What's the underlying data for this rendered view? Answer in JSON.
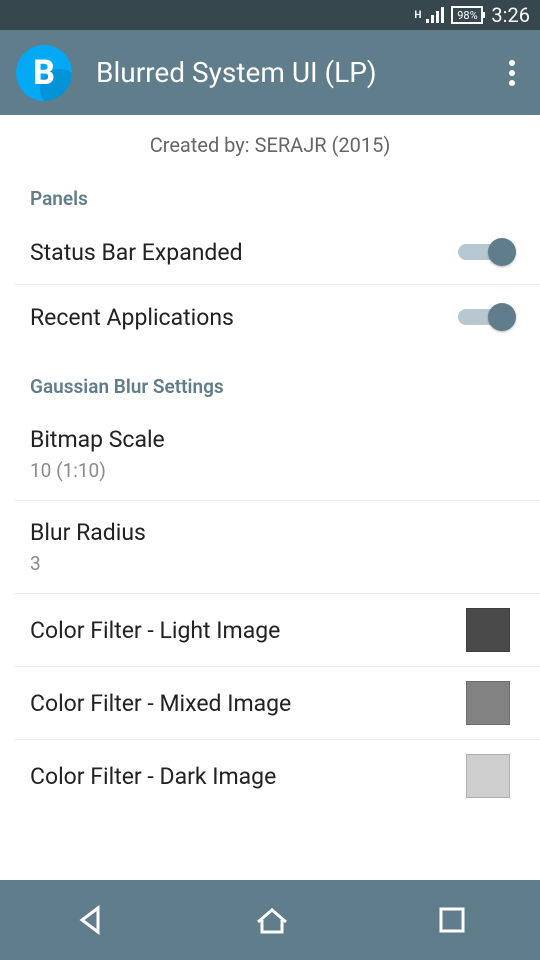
{
  "status": {
    "indicator": "H",
    "battery": "98%",
    "time": "3:26"
  },
  "appbar": {
    "icon_letter": "B",
    "title": "Blurred System UI (LP)"
  },
  "created_by": "Created by: SERAJR (2015)",
  "sections": {
    "panels": {
      "header": "Panels",
      "items": [
        {
          "title": "Status Bar Expanded",
          "toggle": true
        },
        {
          "title": "Recent Applications",
          "toggle": true
        }
      ]
    },
    "gaussian": {
      "header": "Gaussian Blur Settings",
      "bitmap_scale": {
        "title": "Bitmap Scale",
        "sub": "10 (1:10)"
      },
      "blur_radius": {
        "title": "Blur Radius",
        "sub": "3"
      },
      "color_light": {
        "title": "Color Filter - Light Image",
        "color": "#4a4a4a"
      },
      "color_mixed": {
        "title": "Color Filter - Mixed Image",
        "color": "#828282"
      },
      "color_dark": {
        "title": "Color Filter - Dark Image",
        "color": "#cfcfcf"
      }
    }
  }
}
